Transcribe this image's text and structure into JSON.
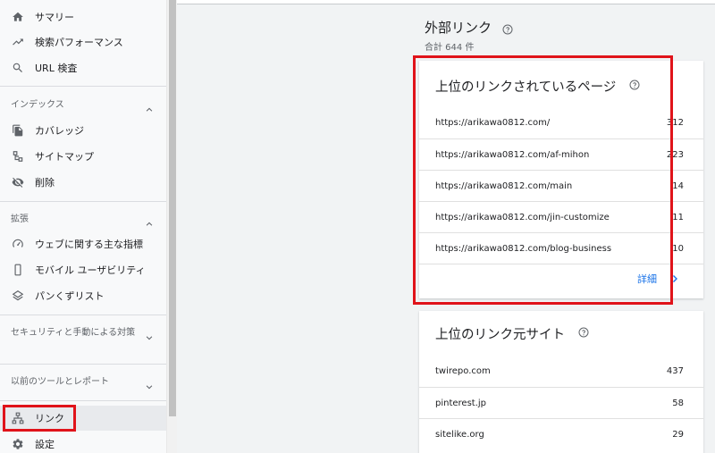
{
  "sidebar": {
    "top_items": [
      {
        "label": "サマリー",
        "icon": "home-icon"
      },
      {
        "label": "検索パフォーマンス",
        "icon": "trending-up-icon"
      },
      {
        "label": "URL 検査",
        "icon": "search-icon"
      }
    ],
    "sections": [
      {
        "title": "インデックス",
        "expanded": true,
        "items": [
          {
            "label": "カバレッジ",
            "icon": "file-copy-icon"
          },
          {
            "label": "サイトマップ",
            "icon": "sitemap-icon"
          },
          {
            "label": "削除",
            "icon": "visibility-off-icon"
          }
        ]
      },
      {
        "title": "拡張",
        "expanded": true,
        "items": [
          {
            "label": "ウェブに関する主な指標",
            "icon": "speed-gauge-icon"
          },
          {
            "label": "モバイル ユーザビリティ",
            "icon": "smartphone-icon"
          },
          {
            "label": "パンくずリスト",
            "icon": "layers-icon"
          }
        ]
      },
      {
        "title": "セキュリティと手動による対策",
        "expanded": false,
        "items": []
      },
      {
        "title": "以前のツールとレポート",
        "expanded": false,
        "items": []
      }
    ],
    "bottom_items": [
      {
        "label": "リンク",
        "icon": "links-network-icon",
        "active": true
      },
      {
        "label": "設定",
        "icon": "gear-icon"
      }
    ]
  },
  "main": {
    "title": "外部リンク",
    "total": "合計 644 件",
    "top_linked_pages": {
      "title": "上位のリンクされているページ",
      "rows": [
        {
          "url": "https://arikawa0812.com/",
          "count": "312"
        },
        {
          "url": "https://arikawa0812.com/af-mihon",
          "count": "223"
        },
        {
          "url": "https://arikawa0812.com/main",
          "count": "14"
        },
        {
          "url": "https://arikawa0812.com/jin-customize",
          "count": "11"
        },
        {
          "url": "https://arikawa0812.com/blog-business",
          "count": "10"
        }
      ],
      "more_label": "詳細"
    },
    "top_linking_sites": {
      "title": "上位のリンク元サイト",
      "rows": [
        {
          "site": "twirepo.com",
          "count": "437"
        },
        {
          "site": "pinterest.jp",
          "count": "58"
        },
        {
          "site": "sitelike.org",
          "count": "29"
        }
      ]
    }
  },
  "colors": {
    "highlight_red": "#e0131a",
    "link_blue": "#1a73e8"
  }
}
